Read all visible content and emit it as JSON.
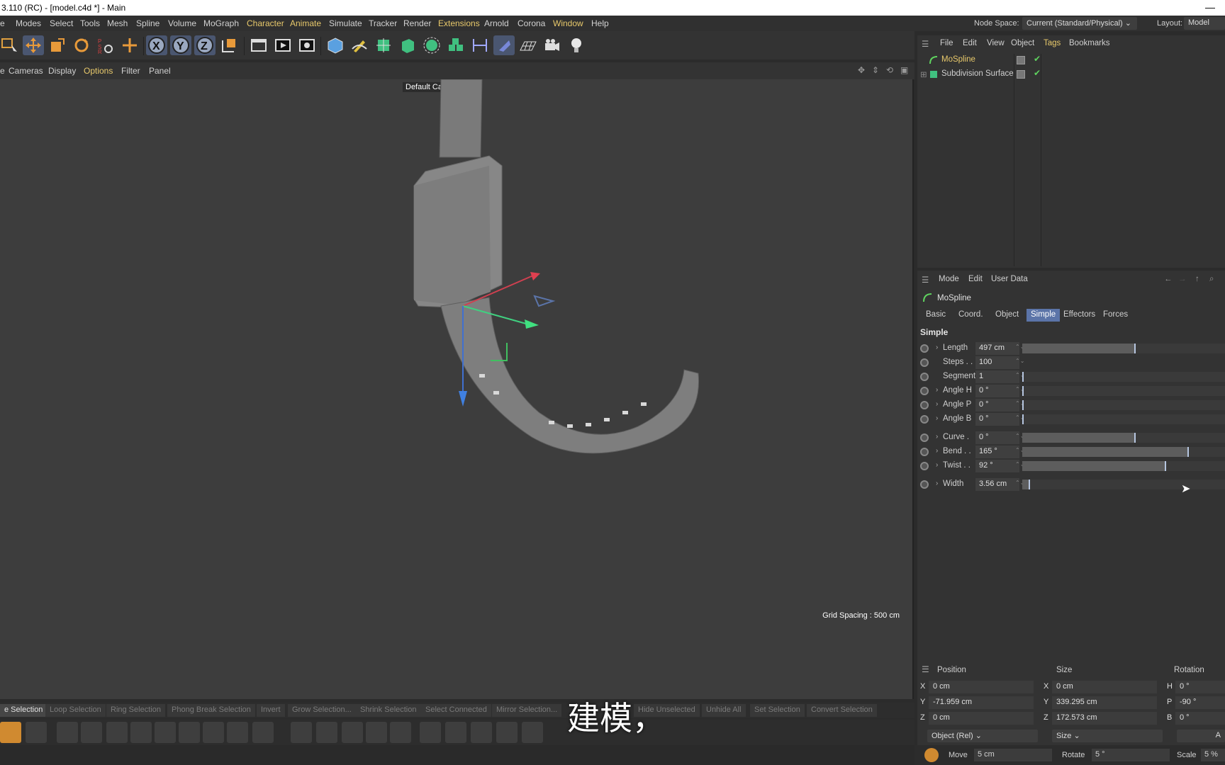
{
  "window": {
    "title": "3.110 (RC) - [model.c4d *] - Main",
    "minimize_glyph": "—"
  },
  "menubar": {
    "items": [
      {
        "label": "e"
      },
      {
        "label": "Modes"
      },
      {
        "label": "Select"
      },
      {
        "label": "Tools"
      },
      {
        "label": "Mesh"
      },
      {
        "label": "Spline"
      },
      {
        "label": "Volume"
      },
      {
        "label": "MoGraph"
      },
      {
        "label": "Character"
      },
      {
        "label": "Animate"
      },
      {
        "label": "Simulate"
      },
      {
        "label": "Tracker"
      },
      {
        "label": "Render"
      },
      {
        "label": "Extensions"
      },
      {
        "label": "Arnold"
      },
      {
        "label": "Corona"
      },
      {
        "label": "Window"
      },
      {
        "label": "Help"
      }
    ],
    "node_space_label": "Node Space:",
    "node_space_value": "Current (Standard/Physical)",
    "layout_label": "Layout:",
    "layout_value": "Model"
  },
  "toolbar": {
    "axis_x": "X",
    "axis_y": "Y",
    "axis_z": "Z",
    "icons": [
      "select-icon",
      "move-icon",
      "scale-icon",
      "rotate-icon",
      "psr-icon",
      "add-icon",
      "lock-x-icon",
      "lock-y-icon",
      "lock-z-icon",
      "coordinate-system-icon",
      "render-region-icon",
      "render-view-icon",
      "render-settings-icon",
      "cube-icon",
      "pen-icon",
      "subdivision-icon",
      "extrude-icon",
      "cloner-icon",
      "mograph-icon",
      "deformer-icon",
      "field-icon",
      "floor-icon",
      "camera-icon",
      "light-icon"
    ]
  },
  "viewport_menu": {
    "items": [
      {
        "label": "e"
      },
      {
        "label": "Cameras"
      },
      {
        "label": "Display"
      },
      {
        "label": "Options"
      },
      {
        "label": "Filter"
      },
      {
        "label": "Panel"
      }
    ]
  },
  "viewport": {
    "camera_label": "Default Camera",
    "grid_spacing": "Grid Spacing : 500 cm"
  },
  "selection_tools": {
    "items": [
      {
        "label": "e Selection"
      },
      {
        "label": "Loop Selection"
      },
      {
        "label": "Ring Selection"
      },
      {
        "label": "Phong Break Selection"
      },
      {
        "label": "Invert"
      },
      {
        "label": "Grow Selection..."
      },
      {
        "label": "Shrink Selection"
      },
      {
        "label": "Select Connected"
      },
      {
        "label": "Mirror Selection..."
      },
      {
        "label": "Hide Unselected"
      },
      {
        "label": "Unhide All"
      },
      {
        "label": "Set Selection"
      },
      {
        "label": "Convert Selection"
      }
    ]
  },
  "subtitle": "建模，",
  "object_manager": {
    "menu": [
      {
        "label": "File"
      },
      {
        "label": "Edit"
      },
      {
        "label": "View"
      },
      {
        "label": "Object"
      },
      {
        "label": "Tags"
      },
      {
        "label": "Bookmarks"
      }
    ],
    "objects": [
      {
        "name": "MoSpline",
        "selected": true
      },
      {
        "name": "Subdivision Surface",
        "selected": false
      }
    ]
  },
  "attribute_manager": {
    "menu": [
      {
        "label": "Mode"
      },
      {
        "label": "Edit"
      },
      {
        "label": "User Data"
      }
    ],
    "object_name": "MoSpline",
    "tabs": [
      {
        "label": "Basic"
      },
      {
        "label": "Coord."
      },
      {
        "label": "Object"
      },
      {
        "label": "Simple"
      },
      {
        "label": "Effectors"
      },
      {
        "label": "Forces"
      }
    ],
    "active_tab": "Simple",
    "section": "Simple",
    "params": [
      {
        "label": "Length",
        "value": "497 cm",
        "level": 0.56,
        "arrow": true
      },
      {
        "label": "Steps . . .",
        "value": "100",
        "level": null,
        "arrow": false
      },
      {
        "label": "Segments",
        "value": "1",
        "level": 0.0,
        "arrow": false
      },
      {
        "label": "Angle H",
        "value": "0 °",
        "level": 0.0,
        "arrow": true
      },
      {
        "label": "Angle P",
        "value": "0 °",
        "level": 0.0,
        "arrow": true
      },
      {
        "label": "Angle B",
        "value": "0 °",
        "level": 0.0,
        "arrow": true
      },
      {
        "label": "Curve  .",
        "value": "0 °",
        "level": 0.56,
        "arrow": true
      },
      {
        "label": "Bend . .",
        "value": "165 °",
        "level": 0.82,
        "arrow": true
      },
      {
        "label": "Twist . .",
        "value": "92 °",
        "level": 0.71,
        "arrow": true
      },
      {
        "label": "Width",
        "value": "3.56 cm",
        "level": 0.04,
        "arrow": true
      }
    ]
  },
  "coordinate_manager": {
    "headers": {
      "position": "Position",
      "size": "Size",
      "rotation": "Rotation"
    },
    "rows": [
      {
        "axis": "X",
        "position": "0 cm",
        "size_axis": "X",
        "size": "0 cm",
        "rot_axis": "H",
        "rotation": "0 °"
      },
      {
        "axis": "Y",
        "position": "-71.959 cm",
        "size_axis": "Y",
        "size": "339.295 cm",
        "rot_axis": "P",
        "rotation": "-90 °"
      },
      {
        "axis": "Z",
        "position": "0 cm",
        "size_axis": "Z",
        "size": "172.573 cm",
        "rot_axis": "B",
        "rotation": "0 °"
      }
    ],
    "mode_select": "Object (Rel)",
    "size_select": "Size",
    "apply": "A"
  },
  "statusbar": {
    "move_label": "Move",
    "move_value": "5 cm",
    "rotate_label": "Rotate",
    "rotate_value": "5 °",
    "scale_label": "Scale",
    "scale_value": "5 %"
  },
  "colors": {
    "accent": "#5b74a8",
    "menu_yellow": "#e8c96b",
    "viewport_bg": "#3d3d3d",
    "panel_bg": "#333333"
  }
}
